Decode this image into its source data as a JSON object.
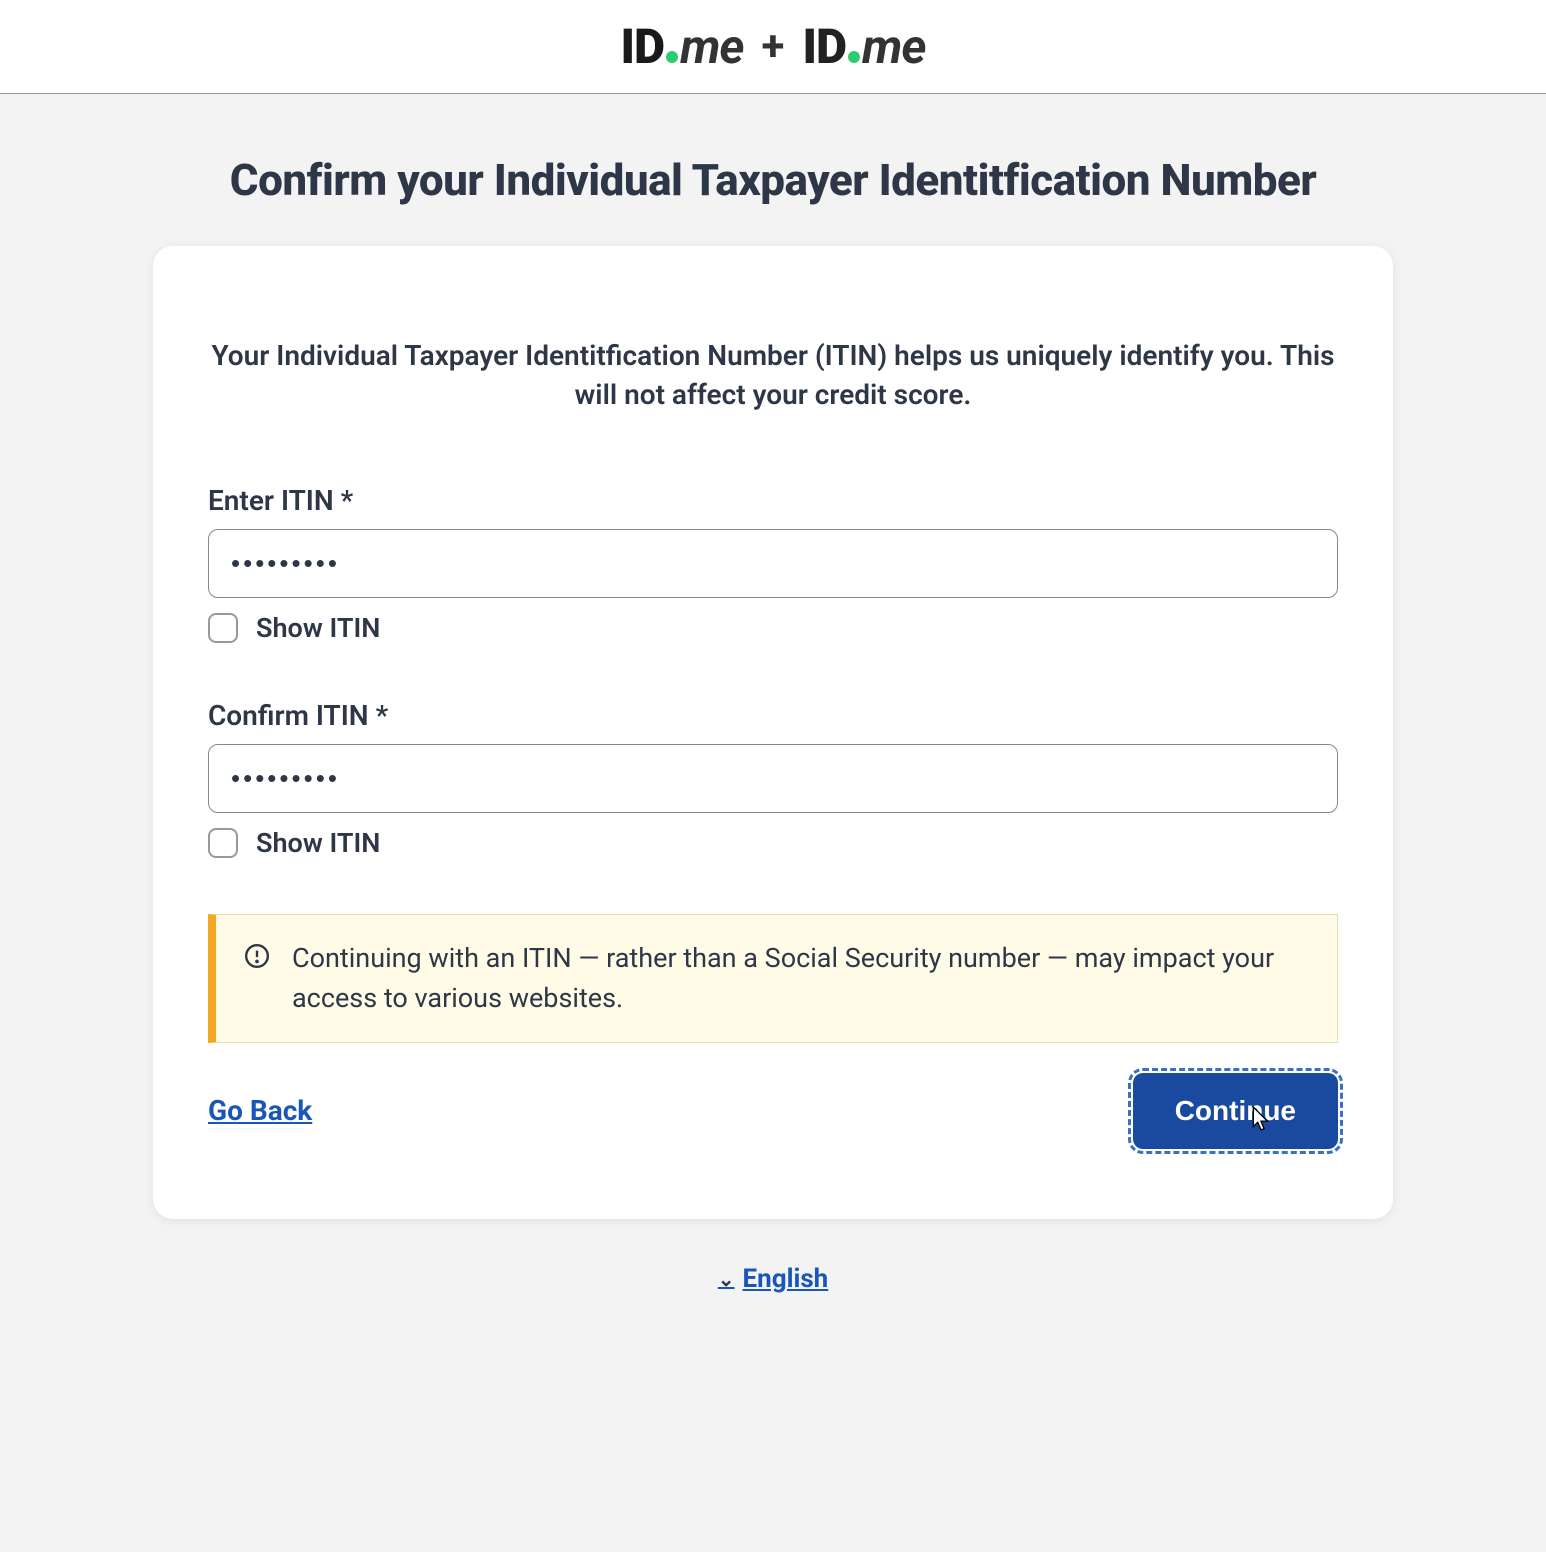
{
  "header": {
    "logo_left_id": "ID",
    "logo_left_me": "me",
    "plus": "+",
    "logo_right_id": "ID",
    "logo_right_me": "me"
  },
  "page": {
    "title": "Confirm your Individual Taxpayer Identitfication Number",
    "intro": "Your Individual Taxpayer Identitfication Number (ITIN) helps us uniquely identify you. This will not affect your credit score."
  },
  "form": {
    "enter_label": "Enter ITIN *",
    "enter_value": "•••••••••",
    "show_enter": "Show ITIN",
    "confirm_label": "Confirm ITIN *",
    "confirm_value": "•••••••••",
    "show_confirm": "Show ITIN"
  },
  "alert": {
    "text": "Continuing with an ITIN — rather than a Social Security number — may impact your access to various websites."
  },
  "actions": {
    "go_back": "Go Back",
    "continue": "Continue"
  },
  "footer": {
    "language": "English"
  }
}
